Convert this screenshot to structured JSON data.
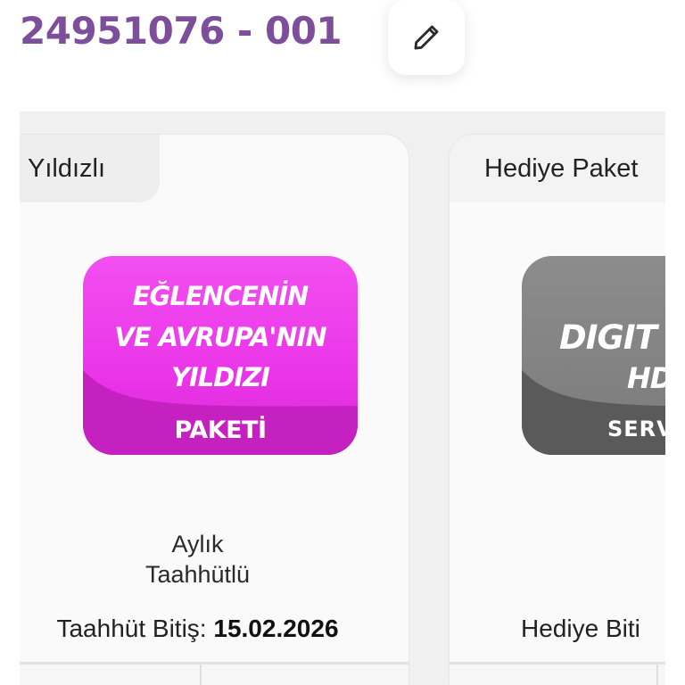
{
  "header": {
    "account_number": "24951076 - 001",
    "edit_icon": "pencil-icon"
  },
  "cards": [
    {
      "tab_label": "Yıldızlı",
      "logo": {
        "line1": "EĞLENCENİN",
        "line2": "VE AVRUPA'NIN",
        "line3": "YILDIZI",
        "line4": "PAKETİ",
        "color": "#ea35e8"
      },
      "term_line1": "Aylık",
      "term_line2": "Taahhütlü",
      "end_label": "Taahhüt Bitiş:",
      "end_date": "15.02.2026"
    },
    {
      "tab_label": "Hediye Paket",
      "logo": {
        "line1": "DIGIT",
        "line2": "HD",
        "line4": "SERV",
        "color": "#7b7b7b"
      },
      "end_label": "Hediye Biti"
    }
  ],
  "colors": {
    "accent": "#7d4e9a",
    "background_band": "#f0f0f0"
  }
}
